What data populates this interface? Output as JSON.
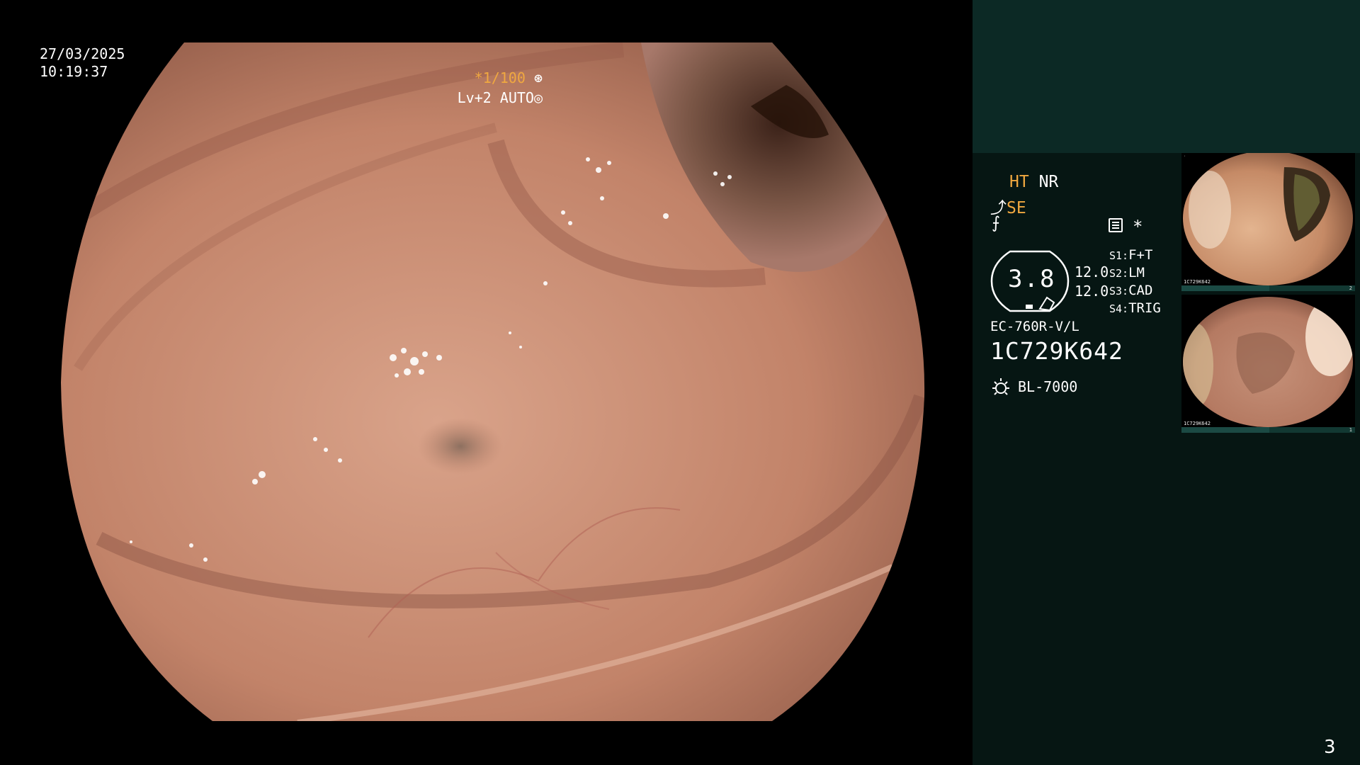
{
  "overlay": {
    "date": "27/03/2025",
    "time": "10:19:37",
    "shutter_prefix": "*",
    "shutter_speed": "1/100",
    "shutter_icon": "aperture-icon",
    "level": "Lv+2",
    "iris_mode": "AUTO",
    "iris_icon": "iris-icon"
  },
  "panel": {
    "ht_label": "HT",
    "nr_label": "NR",
    "se_icon": "structure-icon",
    "se_label": "SE",
    "f_icon": "f-curve-icon",
    "menu_icon": "menu-icon",
    "star_mark": "*",
    "gauge_value": "3.8",
    "value_a": "12.0",
    "value_b": "12.0",
    "switches": [
      {
        "key": "S1:",
        "value": "F+T"
      },
      {
        "key": "S2:",
        "value": "LM"
      },
      {
        "key": "S3:",
        "value": "CAD"
      },
      {
        "key": "S4:",
        "value": "TRIG"
      }
    ],
    "scope_model": "EC-760R-V/L",
    "scope_serial": "1C729K642",
    "light_icon": "light-source-icon",
    "light_source": "BL-7000"
  },
  "thumbnails": [
    {
      "serial": "1C729K642",
      "index": "2"
    },
    {
      "serial": "1C729K642",
      "index": "1"
    }
  ],
  "page_number": "3",
  "colors": {
    "accent": "#f0a840",
    "panel_bg": "#061613",
    "panel_top": "#0c2925",
    "tissue": "#c0806a"
  }
}
